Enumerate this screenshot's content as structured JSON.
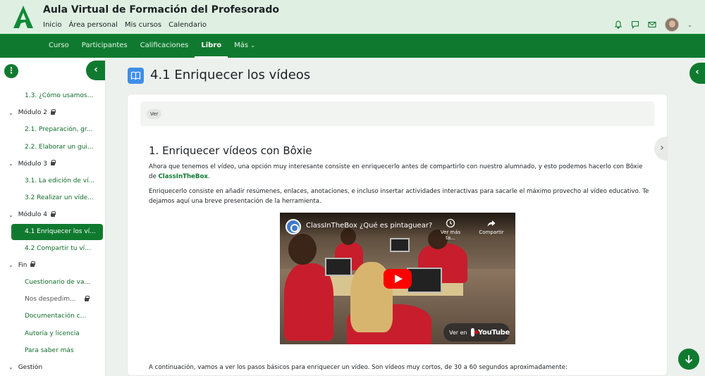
{
  "header": {
    "site_title": "Aula Virtual de Formación del Profesorado",
    "nav": [
      "Inicio",
      "Área personal",
      "Mis cursos",
      "Calendario"
    ],
    "icons": [
      "bell-icon",
      "chat-icon",
      "mail-icon"
    ]
  },
  "coursenav": {
    "tabs": [
      "Curso",
      "Participantes",
      "Calificaciones",
      "Libro",
      "Más"
    ],
    "active": "Libro"
  },
  "drawer": {
    "items": [
      {
        "label": "1.3. ¿Cómo usamos...",
        "kind": "sub"
      },
      {
        "label": "Módulo 2",
        "kind": "section",
        "locked": true
      },
      {
        "label": "2.1. Preparación, gr...",
        "kind": "sub"
      },
      {
        "label": "2.2. Elaborar un gui...",
        "kind": "sub"
      },
      {
        "label": "Módulo 3",
        "kind": "section",
        "locked": true
      },
      {
        "label": "3.1. La edición de ví...",
        "kind": "sub"
      },
      {
        "label": "3.2 Realizar un víde...",
        "kind": "sub"
      },
      {
        "label": "Módulo 4",
        "kind": "section",
        "locked": true
      },
      {
        "label": "4.1 Enriquecer los ví...",
        "kind": "sub",
        "active": true
      },
      {
        "label": "4.2 Compartir tu ví...",
        "kind": "sub"
      },
      {
        "label": "Fin",
        "kind": "section",
        "locked": true
      },
      {
        "label": "Cuestionario de va...",
        "kind": "sub"
      },
      {
        "label": "Nos despedim...",
        "kind": "sub",
        "locked": true,
        "muted": true
      },
      {
        "label": "Documentación c...",
        "kind": "sub"
      },
      {
        "label": "Autoría y licencia",
        "kind": "sub"
      },
      {
        "label": "Para saber más",
        "kind": "sub"
      },
      {
        "label": "Gestión",
        "kind": "section"
      }
    ]
  },
  "page": {
    "title": "4.1 Enriquecer los vídeos",
    "view_label": "Ver",
    "chapter_title": "1. Enriquecer vídeos con Bôxie",
    "p1_before": "Ahora que tenemos el vídeo, una opción muy interesante consiste en enriquecerlo antes de compartirlo con nuestro alumnado, y esto podemos hacerlo con Bôxie de ",
    "p1_link": "ClassInTheBox",
    "p1_after": ".",
    "p2": "Enriquecerlo consiste en añadir resúmenes, enlaces, anotaciones, e incluso insertar actividades interactivas para sacarle el máximo provecho al vídeo educativo. Te dejamos aquí una breve presentación de la herramienta.",
    "p3": "A continuación, vamos a ver los pasos básicos para enriquecer un vídeo. Son vídeos muy cortos, de 30 a 60 segundos aproximadamente:"
  },
  "video": {
    "title": "ClassInTheBox ¿Qué es pintaguear?",
    "watch_later": "Ver más ta...",
    "share": "Compartir",
    "watch_on": "Ver en",
    "brand": "YouTube"
  },
  "colors": {
    "brand_green": "#0f7a2f",
    "header_bg": "#dff0e2",
    "page_bg": "#edf1ed"
  }
}
